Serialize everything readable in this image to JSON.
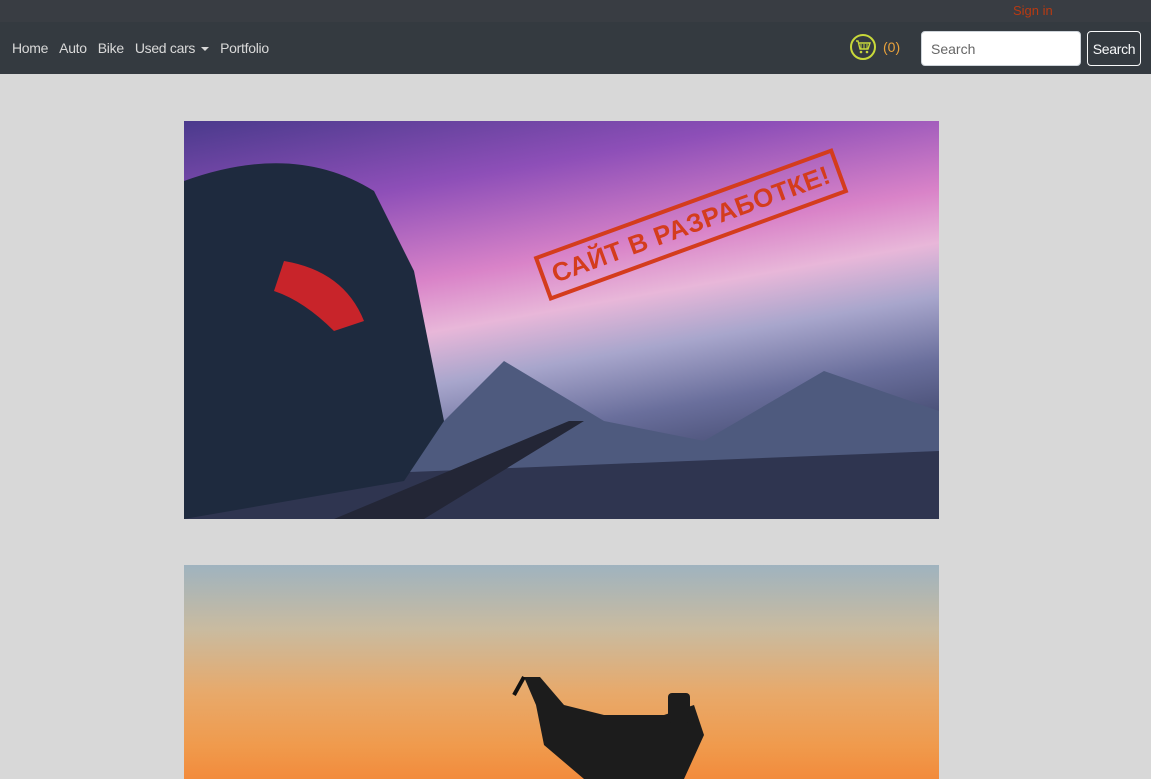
{
  "header": {
    "signin_label": "Sign in"
  },
  "nav": {
    "items": [
      {
        "label": "Home"
      },
      {
        "label": "Auto"
      },
      {
        "label": "Bike"
      },
      {
        "label": "Used cars"
      },
      {
        "label": "Portfolio"
      }
    ],
    "cart_count": "(0)",
    "search_placeholder": "Search",
    "search_button_label": "Search"
  },
  "banners": {
    "car_stamp": "САЙТ В РАЗРАБОТКЕ!"
  },
  "colors": {
    "topbar": "#393d43",
    "navbar": "#343a40",
    "signin": "#b83a12",
    "cart_accent": "#c8d93a",
    "cart_count": "#e9a23b",
    "page_bg": "#d8d8d8"
  }
}
